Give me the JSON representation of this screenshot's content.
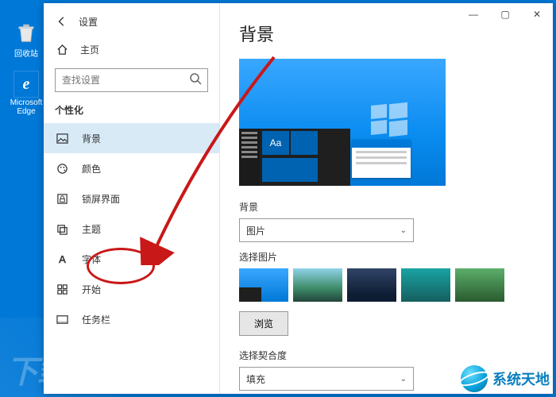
{
  "desktop": {
    "recycle_label": "回收站",
    "edge_label": "Microsoft Edge",
    "edge_glyph": "e"
  },
  "window": {
    "app_name": "设置",
    "controls": {
      "min": "—",
      "max": "▢",
      "close": "✕"
    }
  },
  "sidebar": {
    "home": "主页",
    "search_placeholder": "查找设置",
    "section": "个性化",
    "items": [
      {
        "label": "背景"
      },
      {
        "label": "颜色"
      },
      {
        "label": "锁屏界面"
      },
      {
        "label": "主题"
      },
      {
        "label": "字体"
      },
      {
        "label": "开始"
      },
      {
        "label": "任务栏"
      }
    ]
  },
  "content": {
    "title": "背景",
    "preview_tile_text": "Aa",
    "bg_label": "背景",
    "bg_value": "图片",
    "choose_label": "选择图片",
    "browse": "浏览",
    "fit_label": "选择契合度",
    "fit_value": "填充"
  },
  "watermark": {
    "left_text": "下载吧",
    "brand": "系统天地"
  }
}
